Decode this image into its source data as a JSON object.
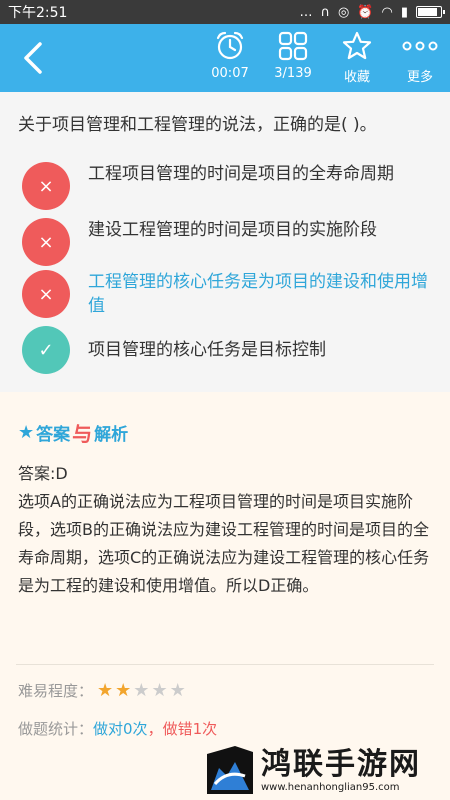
{
  "status_bar": {
    "time": "下午2:51",
    "battery_level": 0.9
  },
  "toolbar": {
    "timer_label": "00:07",
    "progress_label": "3/139",
    "favorite_label": "收藏",
    "more_label": "更多",
    "icons": [
      "back-arrow-icon",
      "alarm-clock-icon",
      "grid-icon",
      "star-outline-icon",
      "more-dots-icon"
    ]
  },
  "question": {
    "text": "关于项目管理和工程管理的说法，正确的是(   )。",
    "options": [
      {
        "mark": "×",
        "text": "工程项目管理的时间是项目的全寿命周期",
        "state": "wrong"
      },
      {
        "mark": "×",
        "text": "建设工程管理的时间是项目的实施阶段",
        "state": "wrong"
      },
      {
        "mark": "×",
        "text": "工程管理的核心任务是为项目的建设和使用增值",
        "state": "wrong-selected"
      },
      {
        "mark": "✓",
        "text": "项目管理的核心任务是目标控制",
        "state": "correct"
      }
    ]
  },
  "analysis": {
    "heading_answer": "答案",
    "heading_with": "与",
    "heading_analysis": "解析",
    "answer_line": "答案:D",
    "explanation": "选项A的正确说法应为工程项目管理的时间是项目实施阶段，选项B的正确说法应为建设工程管理的时间是项目的全寿命周期，选项C的正确说法应为建设工程管理的核心任务是为工程的建设和使用增值。所以D正确。",
    "difficulty_label": "难易程度：",
    "difficulty_rating": 2,
    "difficulty_max": 5,
    "stats_label": "做题统计：",
    "stats_correct": "做对0次",
    "stats_sep": "，",
    "stats_wrong": "做错1次"
  },
  "watermark": {
    "main": "鸿联手游网",
    "url": "www.henanhonglian95.com"
  },
  "colors": {
    "toolbar": "#3db1ea",
    "wrong": "#ef5b5b",
    "correct": "#52c7b8",
    "highlight": "#2fa6d9",
    "star_on": "#f2a52d"
  }
}
